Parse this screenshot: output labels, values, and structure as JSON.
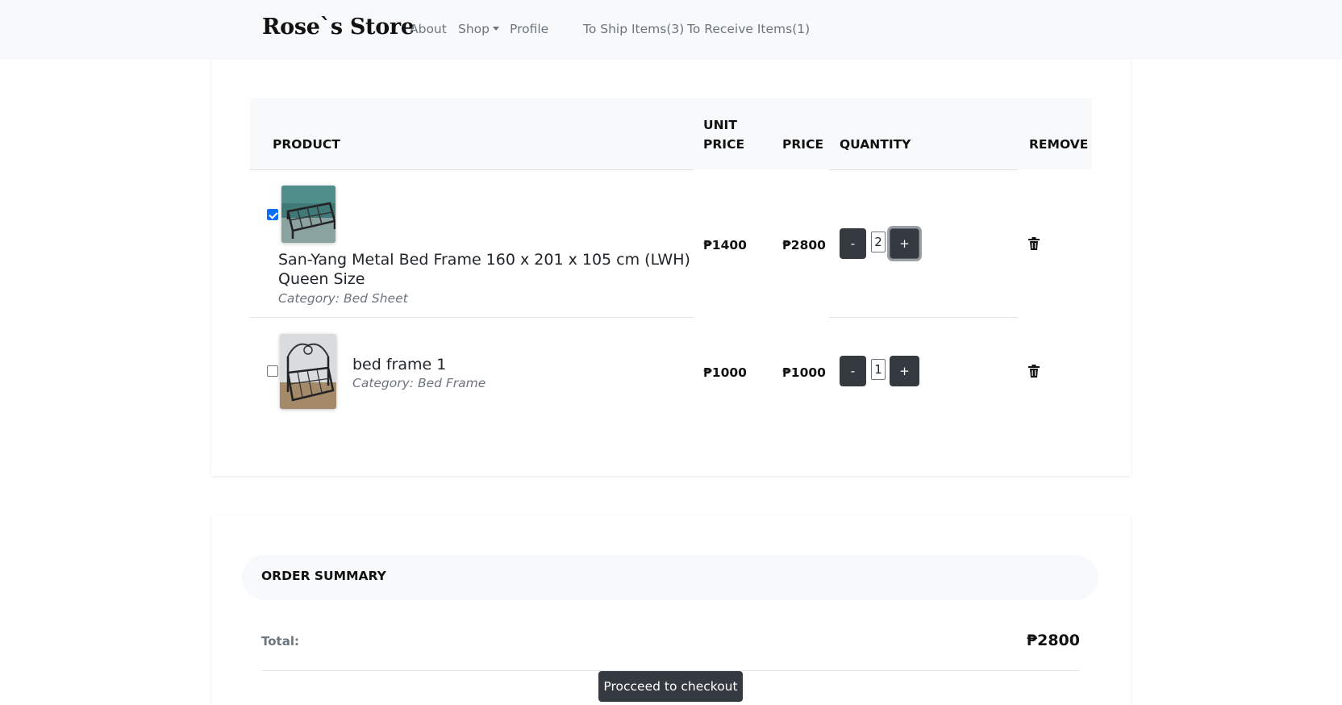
{
  "navbar": {
    "brand": "Rose`s Store",
    "links": {
      "about": "About",
      "shop": "Shop",
      "profile": "Profile",
      "to_ship": "To Ship Items(3)",
      "to_receive": "To Receive Items(1)"
    }
  },
  "cart": {
    "headers": {
      "product": "PRODUCT",
      "unit_line1": "UNIT",
      "unit_line2": "PRICE",
      "price": "PRICE",
      "quantity": "QUANTITY",
      "remove": "REMOVE"
    },
    "items": [
      {
        "checked": true,
        "name_line1": "San-Yang Metal Bed Frame 160 x 201 x 105 cm (LWH)",
        "name_line2": "Queen Size",
        "category": "Category: Bed Sheet",
        "unit_price": "₱1400",
        "price": "₱2800",
        "quantity": "2",
        "minus": "-",
        "plus": "+"
      },
      {
        "checked": false,
        "name": "bed frame 1",
        "category": "Category: Bed Frame",
        "unit_price": "₱1000",
        "price": "₱1000",
        "quantity": "1",
        "minus": "-",
        "plus": "+"
      }
    ]
  },
  "summary": {
    "title": "ORDER SUMMARY",
    "total_label": "Total:",
    "total_value": "₱2800",
    "checkout_label": "Procceed to checkout"
  },
  "colors": {
    "navbar_bg": "#f8f9fa",
    "button_dark": "#343a40",
    "checkbox_checked": "#0d6efd",
    "muted_text": "#6c757d"
  },
  "icons": {
    "remove": "trash-icon",
    "checkbox": "checkbox"
  }
}
